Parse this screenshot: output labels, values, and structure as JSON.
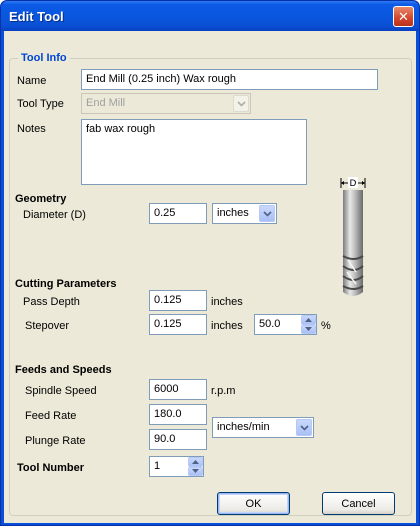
{
  "window": {
    "title": "Edit Tool"
  },
  "tool_info": {
    "legend": "Tool Info",
    "name_label": "Name",
    "name_value": "End Mill (0.25 inch) Wax rough",
    "tool_type_label": "Tool Type",
    "tool_type_value": "End Mill",
    "notes_label": "Notes",
    "notes_value": "fab wax rough"
  },
  "geometry": {
    "heading": "Geometry",
    "diameter_label": "Diameter (D)",
    "diameter_value": "0.25",
    "unit_value": "inches",
    "diagram_label": "D"
  },
  "cutting": {
    "heading": "Cutting Parameters",
    "pass_depth_label": "Pass Depth",
    "pass_depth_value": "0.125",
    "pass_depth_unit": "inches",
    "stepover_label": "Stepover",
    "stepover_value": "0.125",
    "stepover_unit": "inches",
    "stepover_percent_value": "50.0",
    "percent_sign": "%"
  },
  "feeds": {
    "heading": "Feeds and Speeds",
    "spindle_label": "Spindle Speed",
    "spindle_value": "6000",
    "spindle_unit": "r.p.m",
    "feed_label": "Feed Rate",
    "feed_value": "180.0",
    "plunge_label": "Plunge Rate",
    "plunge_value": "90.0",
    "rate_unit_value": "inches/min"
  },
  "tool_number": {
    "label": "Tool Number",
    "value": "1"
  },
  "buttons": {
    "ok": "OK",
    "cancel": "Cancel"
  },
  "icons": {
    "close": "close-icon",
    "dropdown": "chevron-down-icon",
    "spin_up": "arrow-up-icon",
    "spin_down": "arrow-down-icon",
    "end_mill": "end-mill-icon"
  }
}
